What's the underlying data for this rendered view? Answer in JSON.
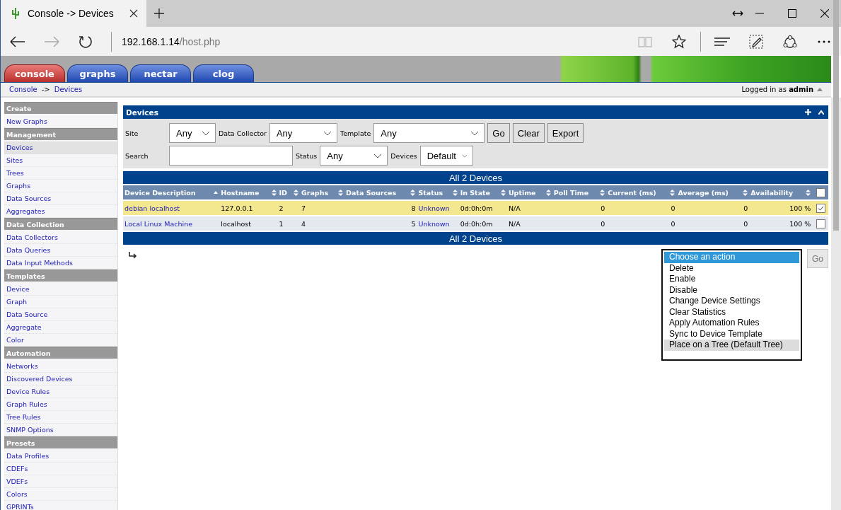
{
  "browser": {
    "tab_title": "Console -> Devices",
    "address_host": "192.168.1.14",
    "address_path": "/host.php"
  },
  "app_tabs": [
    {
      "label": "console",
      "selected": true
    },
    {
      "label": "graphs",
      "selected": false
    },
    {
      "label": "nectar",
      "selected": false
    },
    {
      "label": "clog",
      "selected": false
    }
  ],
  "breadcrumb": {
    "items": [
      "Console",
      "Devices"
    ],
    "separator": "->"
  },
  "user": {
    "prefix": "Logged in as",
    "name": "admin"
  },
  "sidebar": {
    "sections": [
      {
        "title": "Create",
        "items": [
          {
            "label": "New Graphs",
            "selected": false
          }
        ]
      },
      {
        "title": "Management",
        "items": [
          {
            "label": "Devices",
            "selected": true
          },
          {
            "label": "Sites",
            "selected": false
          },
          {
            "label": "Trees",
            "selected": false
          },
          {
            "label": "Graphs",
            "selected": false
          },
          {
            "label": "Data Sources",
            "selected": false
          },
          {
            "label": "Aggregates",
            "selected": false
          }
        ]
      },
      {
        "title": "Data Collection",
        "items": [
          {
            "label": "Data Collectors",
            "selected": false
          },
          {
            "label": "Data Queries",
            "selected": false
          },
          {
            "label": "Data Input Methods",
            "selected": false
          }
        ]
      },
      {
        "title": "Templates",
        "items": [
          {
            "label": "Device",
            "selected": false
          },
          {
            "label": "Graph",
            "selected": false
          },
          {
            "label": "Data Source",
            "selected": false
          },
          {
            "label": "Aggregate",
            "selected": false
          },
          {
            "label": "Color",
            "selected": false
          }
        ]
      },
      {
        "title": "Automation",
        "items": [
          {
            "label": "Networks",
            "selected": false
          },
          {
            "label": "Discovered Devices",
            "selected": false
          },
          {
            "label": "Device Rules",
            "selected": false
          },
          {
            "label": "Graph Rules",
            "selected": false
          },
          {
            "label": "Tree Rules",
            "selected": false
          },
          {
            "label": "SNMP Options",
            "selected": false
          }
        ]
      },
      {
        "title": "Presets",
        "items": [
          {
            "label": "Data Profiles",
            "selected": false
          },
          {
            "label": "CDEFs",
            "selected": false
          },
          {
            "label": "VDEFs",
            "selected": false
          },
          {
            "label": "Colors",
            "selected": false
          },
          {
            "label": "GPRINTs",
            "selected": false
          }
        ]
      }
    ]
  },
  "panel": {
    "title": "Devices",
    "filter_rows": [
      [
        {
          "kind": "select",
          "label": "Site",
          "value": "Any"
        },
        {
          "kind": "select",
          "label": "Data Collector",
          "value": "Any"
        },
        {
          "kind": "select",
          "label": "Template",
          "value": "Any"
        },
        {
          "kind": "button",
          "label": "Go"
        },
        {
          "kind": "button",
          "label": "Clear"
        },
        {
          "kind": "button",
          "label": "Export"
        }
      ],
      [
        {
          "kind": "text",
          "label": "Search"
        },
        {
          "kind": "select",
          "label": "Status",
          "value": "Any"
        },
        {
          "kind": "select",
          "label": "Devices",
          "value": "Default"
        }
      ]
    ]
  },
  "table": {
    "caption": "All 2 Devices",
    "columns": [
      {
        "label": "Device Description",
        "sorted": true
      },
      {
        "label": "Hostname",
        "sorted": false
      },
      {
        "label": "ID",
        "sorted": false
      },
      {
        "label": "Graphs",
        "sorted": false
      },
      {
        "label": "Data Sources",
        "sorted": false
      },
      {
        "label": "Status",
        "sorted": false
      },
      {
        "label": "In State",
        "sorted": false
      },
      {
        "label": "Uptime",
        "sorted": false
      },
      {
        "label": "Poll Time",
        "sorted": false
      },
      {
        "label": "Current (ms)",
        "sorted": false
      },
      {
        "label": "Average (ms)",
        "sorted": false
      },
      {
        "label": "Availability",
        "sorted": false
      }
    ],
    "all_checked": false,
    "rows": [
      {
        "selected": true,
        "cells": [
          "debian localhost",
          "127.0.0.1",
          "2",
          "7",
          "8",
          "Unknown",
          "0d:0h:0m",
          "N/A",
          "0",
          "0",
          "0",
          "100 %"
        ]
      },
      {
        "selected": false,
        "cells": [
          "Local Linux Machine",
          "localhost",
          "1",
          "4",
          "5",
          "Unknown",
          "0d:0h:0m",
          "N/A",
          "0",
          "0",
          "0",
          "100 %"
        ]
      }
    ],
    "footer": "All 2 Devices"
  },
  "actions": {
    "options": [
      {
        "label": "Choose an action",
        "selected": true,
        "hovered": false
      },
      {
        "label": "Delete",
        "selected": false,
        "hovered": false
      },
      {
        "label": "Enable",
        "selected": false,
        "hovered": false
      },
      {
        "label": "Disable",
        "selected": false,
        "hovered": false
      },
      {
        "label": "Change Device Settings",
        "selected": false,
        "hovered": false
      },
      {
        "label": "Clear Statistics",
        "selected": false,
        "hovered": false
      },
      {
        "label": "Apply Automation Rules",
        "selected": false,
        "hovered": false
      },
      {
        "label": "Sync to Device Template",
        "selected": false,
        "hovered": false
      },
      {
        "label": "Place on a Tree (Default Tree)",
        "selected": false,
        "hovered": true
      }
    ],
    "button": "Go"
  }
}
